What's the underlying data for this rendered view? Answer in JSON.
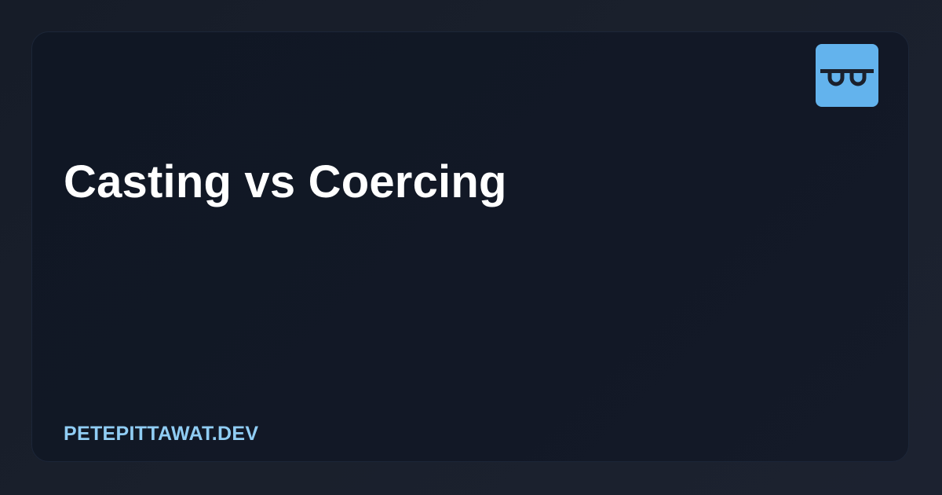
{
  "card": {
    "title": "Casting vs Coercing",
    "site": "PETEPITTAWAT.DEV"
  },
  "logo": {
    "icon": "glasses-logo-icon",
    "background_color": "#63b3ed",
    "foreground_color": "#1a202c"
  },
  "colors": {
    "page_background": "#1a202c",
    "card_background": "#111827",
    "title_text": "#ffffff",
    "site_text": "#90cdf4"
  }
}
